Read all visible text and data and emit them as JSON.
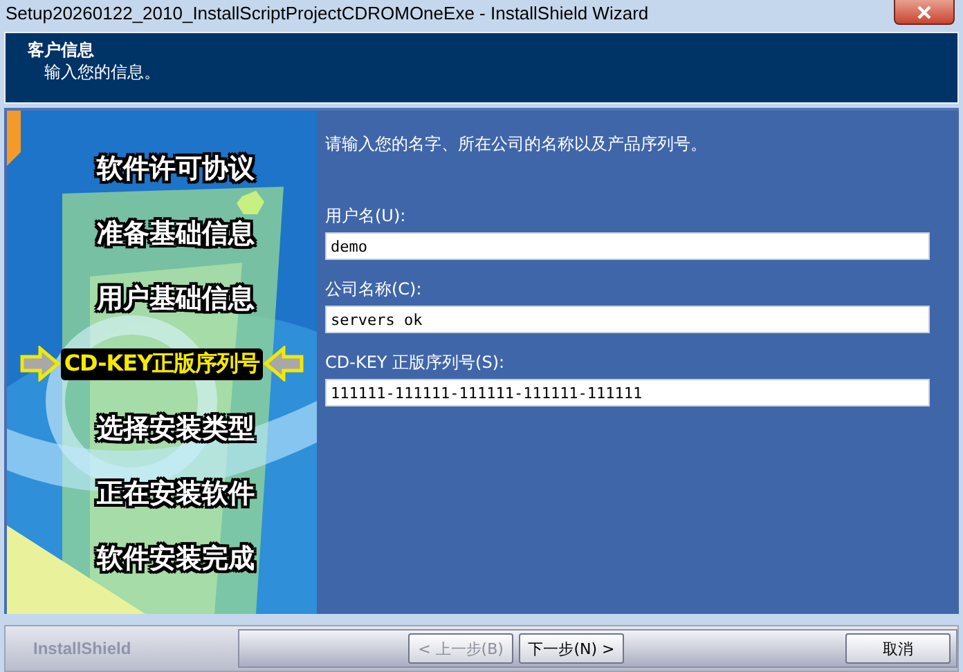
{
  "window": {
    "title": "Setup20260122_2010_InstallScriptProjectCDROMOneExe - InstallShield Wizard"
  },
  "header": {
    "title": "客户信息",
    "subtitle": "输入您的信息。"
  },
  "steps": [
    {
      "label": "软件许可协议",
      "selected": false
    },
    {
      "label": "准备基础信息",
      "selected": false
    },
    {
      "label": "用户基础信息",
      "selected": false
    },
    {
      "label": "CD-KEY正版序列号",
      "selected": true
    },
    {
      "label": "选择安装类型",
      "selected": false
    },
    {
      "label": "正在安装软件",
      "selected": false
    },
    {
      "label": "软件安装完成",
      "selected": false
    }
  ],
  "instruction": "请输入您的名字、所在公司的名称以及产品序列号。",
  "fields": [
    {
      "label": "用户名(U):",
      "value": "demo"
    },
    {
      "label": "公司名称(C):",
      "value": "servers ok"
    },
    {
      "label": "CD-KEY 正版序列号(S):",
      "value": "111111-111111-111111-111111-111111"
    }
  ],
  "footer": {
    "brand": "InstallShield"
  },
  "buttons": [
    {
      "label": "< 上一步(B)",
      "disabled": true
    },
    {
      "label": "下一步(N) >",
      "disabled": false
    },
    {
      "label": "取消",
      "disabled": false
    }
  ]
}
